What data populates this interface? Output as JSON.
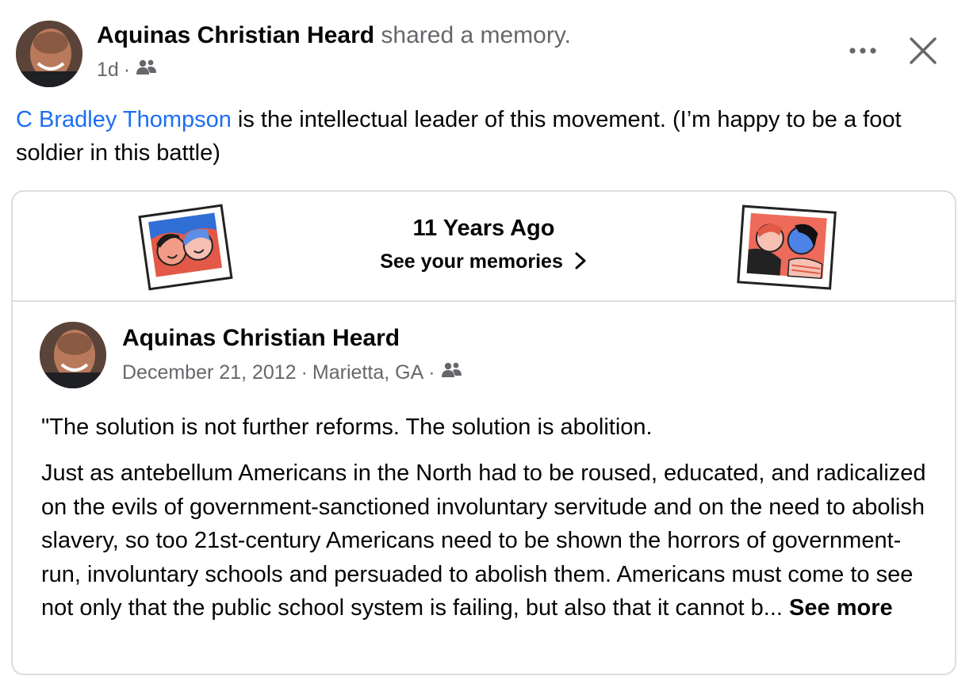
{
  "post": {
    "author": "Aquinas Christian Heard",
    "action": "shared a memory.",
    "time": "1d",
    "separator": "·",
    "audience_icon": "friends-icon",
    "text_mention": "C Bradley Thompson",
    "text_rest": " is the intellectual leader of this movement. (I’m happy to be a foot soldier in this battle)"
  },
  "header_actions": {
    "more_icon": "more-horizontal-icon",
    "close_icon": "close-icon"
  },
  "memory_banner": {
    "title": "11 Years Ago",
    "link_label": "See your memories",
    "chevron_icon": "chevron-right-icon"
  },
  "original_post": {
    "author": "Aquinas Christian Heard",
    "date": "December 21, 2012",
    "location": "Marietta, GA",
    "separator": "·",
    "audience_icon": "friends-icon",
    "quote": "\"The solution is not further reforms. The solution is abolition.",
    "body": "Just as antebellum Americans in the North had to be roused, educated, and radicalized on the evils of government-sanctioned involuntary servitude and on the need to abolish slavery, so too 21st-century Americans need to be shown the horrors of government-run, involuntary schools and persuaded to abolish them. Americans must come to see not only that the public school system is failing, but also that it cannot b...",
    "see_more": "See more"
  },
  "colors": {
    "mention": "#1b6ef3",
    "secondary_text": "#65676b",
    "border": "#dadde1"
  }
}
